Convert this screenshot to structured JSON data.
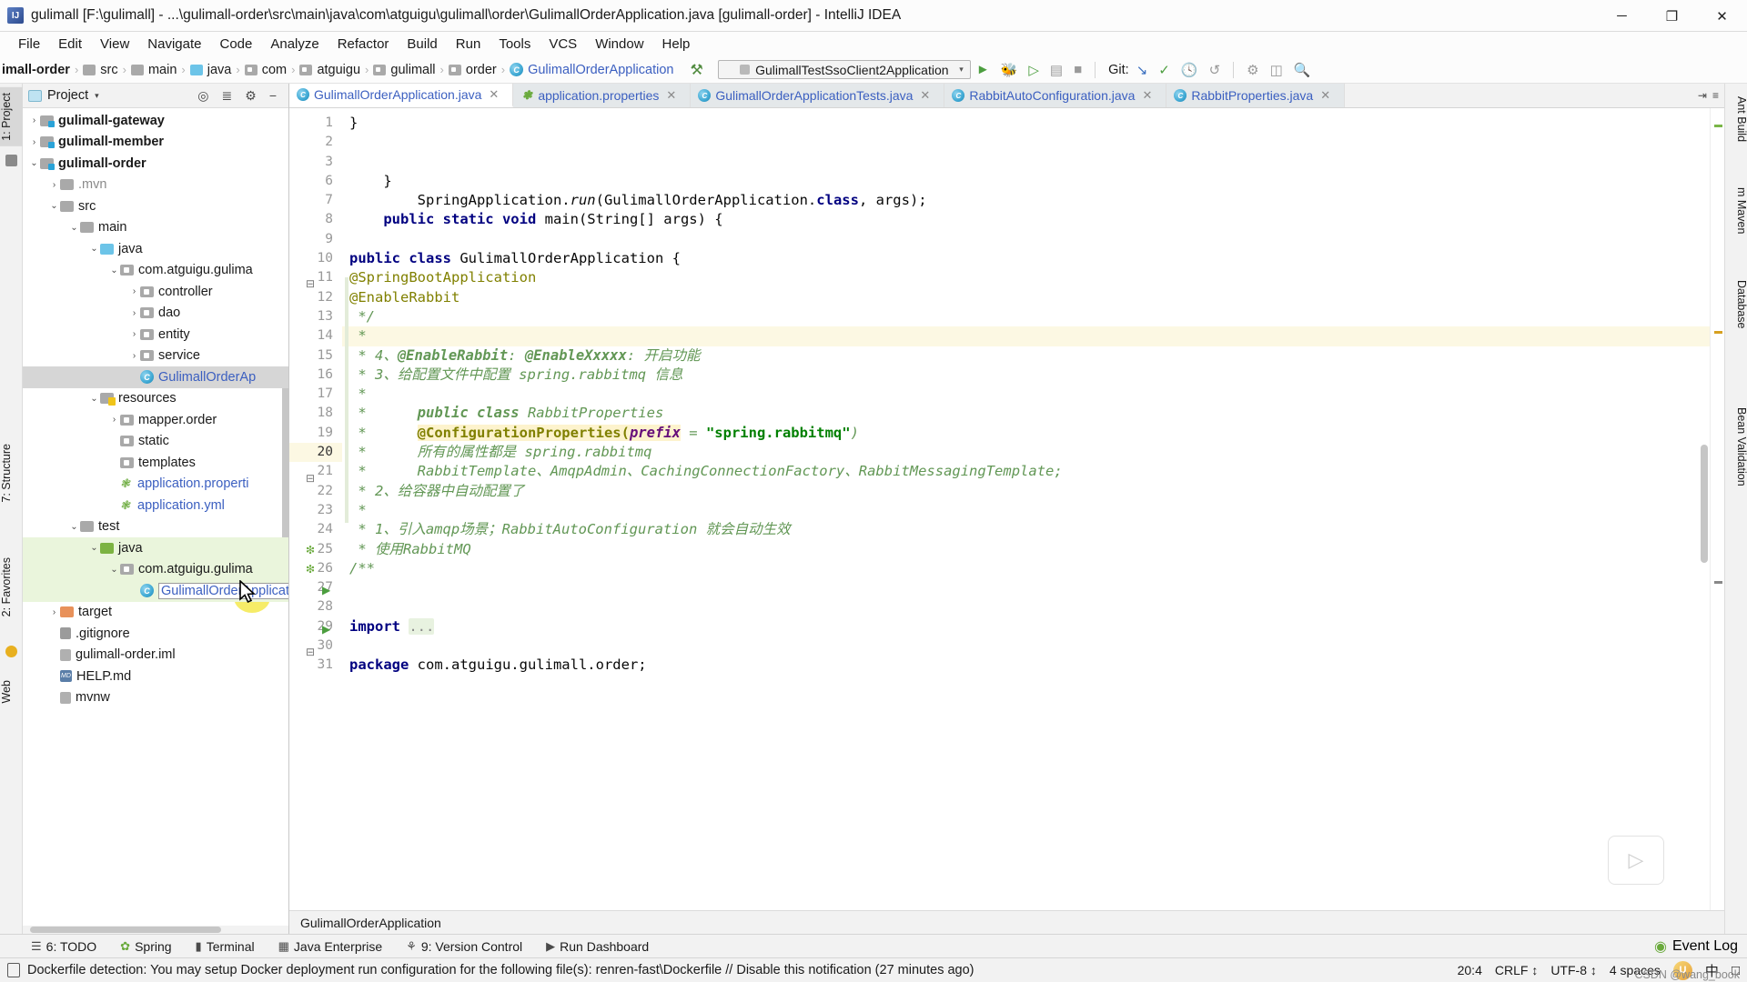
{
  "window": {
    "title": "gulimall [F:\\gulimall] - ...\\gulimall-order\\src\\main\\java\\com\\atguigu\\gulimall\\order\\GulimallOrderApplication.java [gulimall-order] - IntelliJ IDEA",
    "app_icon": "intellij-idea-icon",
    "minimize": "─",
    "maximize": "❐",
    "close": "✕"
  },
  "menubar": {
    "items": [
      {
        "label": "File"
      },
      {
        "label": "Edit"
      },
      {
        "label": "View"
      },
      {
        "label": "Navigate"
      },
      {
        "label": "Code"
      },
      {
        "label": "Analyze"
      },
      {
        "label": "Refactor"
      },
      {
        "label": "Build"
      },
      {
        "label": "Run"
      },
      {
        "label": "Tools"
      },
      {
        "label": "VCS"
      },
      {
        "label": "Window"
      },
      {
        "label": "Help"
      }
    ]
  },
  "breadcrumb": {
    "items": [
      {
        "label": "imall-order",
        "icon": "module-icon"
      },
      {
        "label": "src",
        "icon": "folder-icon"
      },
      {
        "label": "main",
        "icon": "folder-icon"
      },
      {
        "label": "java",
        "icon": "source-folder-icon"
      },
      {
        "label": "com",
        "icon": "package-icon"
      },
      {
        "label": "atguigu",
        "icon": "package-icon"
      },
      {
        "label": "gulimall",
        "icon": "package-icon"
      },
      {
        "label": "order",
        "icon": "package-icon"
      },
      {
        "label": "GulimallOrderApplication",
        "icon": "java-class-icon"
      }
    ],
    "separator": "›"
  },
  "toolbar": {
    "build_icon": "hammer-icon",
    "run_config": "GulimallTestSsoClient2Application",
    "run_config_caret": "▾",
    "run_button": "run-icon",
    "debug_button": "debug-icon",
    "run_coverage_button": "run-with-coverage-icon",
    "profiler_button": "profiler-icon",
    "stop_button": "stop-icon",
    "git_label": "Git:",
    "git_update": "update-project-icon",
    "git_commit": "commit-icon",
    "git_history": "history-icon",
    "git_rollback": "rollback-icon",
    "settings_icon": "settings-icon",
    "layout_icon": "layout-icon",
    "search_icon": "search-icon"
  },
  "left_strips": [
    {
      "label": "1: Project",
      "selected": true
    },
    {
      "label": "7: Structure",
      "selected": false
    },
    {
      "label": "2: Favorites",
      "selected": false
    },
    {
      "label": "Web",
      "selected": false
    }
  ],
  "right_strips": [
    {
      "label": "Ant Build"
    },
    {
      "label": "m Maven"
    },
    {
      "label": "Database"
    },
    {
      "label": "Bean Validation"
    }
  ],
  "project_panel": {
    "title": "Project",
    "title_caret": "▾",
    "panel_icon": "project-view-icon",
    "locate_icon": "locate-icon",
    "collapse_icon": "collapse-all-icon",
    "settings_icon": "gear-icon",
    "hide_icon": "hide-icon",
    "tree": [
      {
        "label": "gulimall-gateway",
        "indent": 1,
        "arrow": "›",
        "icon": "module-icon",
        "style": "bold"
      },
      {
        "label": "gulimall-member",
        "indent": 1,
        "arrow": "›",
        "icon": "module-icon",
        "style": "bold"
      },
      {
        "label": "gulimall-order",
        "indent": 1,
        "arrow": "⌄",
        "icon": "module-icon",
        "style": "bold"
      },
      {
        "label": ".mvn",
        "indent": 2,
        "arrow": "›",
        "icon": "folder-icon",
        "style": "grey"
      },
      {
        "label": "src",
        "indent": 2,
        "arrow": "⌄",
        "icon": "folder-icon",
        "style": "normal"
      },
      {
        "label": "main",
        "indent": 3,
        "arrow": "⌄",
        "icon": "folder-icon",
        "style": "normal"
      },
      {
        "label": "java",
        "indent": 4,
        "arrow": "⌄",
        "icon": "source-folder-icon",
        "style": "normal"
      },
      {
        "label": "com.atguigu.gulima",
        "indent": 5,
        "arrow": "⌄",
        "icon": "package-icon",
        "style": "normal"
      },
      {
        "label": "controller",
        "indent": 6,
        "arrow": "›",
        "icon": "package-icon",
        "style": "normal"
      },
      {
        "label": "dao",
        "indent": 6,
        "arrow": "›",
        "icon": "package-icon",
        "style": "normal"
      },
      {
        "label": "entity",
        "indent": 6,
        "arrow": "›",
        "icon": "package-icon",
        "style": "normal"
      },
      {
        "label": "service",
        "indent": 6,
        "arrow": "›",
        "icon": "package-icon",
        "style": "normal"
      },
      {
        "label": "GulimallOrderAp",
        "indent": 6,
        "arrow": "",
        "icon": "java-class-icon",
        "style": "blue",
        "selected": true
      },
      {
        "label": "resources",
        "indent": 4,
        "arrow": "⌄",
        "icon": "resources-folder-icon",
        "style": "normal"
      },
      {
        "label": "mapper.order",
        "indent": 5,
        "arrow": "›",
        "icon": "package-icon",
        "style": "normal"
      },
      {
        "label": "static",
        "indent": 5,
        "arrow": "",
        "icon": "package-icon",
        "style": "normal"
      },
      {
        "label": "templates",
        "indent": 5,
        "arrow": "",
        "icon": "package-icon",
        "style": "normal"
      },
      {
        "label": "application.properti",
        "indent": 5,
        "arrow": "",
        "icon": "spring-properties-icon",
        "style": "blue"
      },
      {
        "label": "application.yml",
        "indent": 5,
        "arrow": "",
        "icon": "spring-properties-icon",
        "style": "blue"
      },
      {
        "label": "test",
        "indent": 3,
        "arrow": "⌄",
        "icon": "folder-icon",
        "style": "normal"
      },
      {
        "label": "java",
        "indent": 4,
        "arrow": "⌄",
        "icon": "test-source-folder-icon",
        "style": "normal",
        "green": true
      },
      {
        "label": "com.atguigu.gulima",
        "indent": 5,
        "arrow": "⌄",
        "icon": "package-icon",
        "style": "normal",
        "green": true
      },
      {
        "label": "GulimallOrderApplicationTests",
        "indent": 6,
        "arrow": "",
        "icon": "java-class-icon",
        "style": "blue",
        "green": true,
        "boxed": true
      },
      {
        "label": "target",
        "indent": 2,
        "arrow": "›",
        "icon": "target-folder-icon",
        "style": "normal"
      },
      {
        "label": ".gitignore",
        "indent": 2,
        "arrow": "",
        "icon": "gitignore-icon",
        "style": "normal"
      },
      {
        "label": "gulimall-order.iml",
        "indent": 2,
        "arrow": "",
        "icon": "iml-icon",
        "style": "normal"
      },
      {
        "label": "HELP.md",
        "indent": 2,
        "arrow": "",
        "icon": "markdown-icon",
        "style": "normal"
      },
      {
        "label": "mvnw",
        "indent": 2,
        "arrow": "",
        "icon": "file-icon",
        "style": "normal"
      }
    ]
  },
  "editor": {
    "tabs": [
      {
        "label": "GulimallOrderApplication.java",
        "icon": "java-class-icon",
        "active": true,
        "close": "✕"
      },
      {
        "label": "application.properties",
        "icon": "spring-properties-icon",
        "active": false,
        "close": "✕"
      },
      {
        "label": "GulimallOrderApplicationTests.java",
        "icon": "java-class-icon",
        "active": false,
        "close": "✕"
      },
      {
        "label": "RabbitAutoConfiguration.java",
        "icon": "java-class-icon",
        "active": false,
        "close": "✕"
      },
      {
        "label": "RabbitProperties.java",
        "icon": "java-class-icon",
        "active": false,
        "close": "✕"
      }
    ],
    "tab_overflow": "⇥",
    "tab_menu": "≡",
    "line_numbers": [
      1,
      2,
      3,
      6,
      7,
      8,
      9,
      10,
      11,
      12,
      13,
      14,
      15,
      16,
      17,
      18,
      19,
      20,
      21,
      22,
      23,
      24,
      25,
      26,
      27,
      28,
      29,
      30,
      31
    ],
    "current_line": 20,
    "status_breadcrumb": "GulimallOrderApplication",
    "code_lines": [
      {
        "n": 1,
        "text": "package com.atguigu.gulimall.order;"
      },
      {
        "n": 2,
        "text": ""
      },
      {
        "n": 3,
        "text": "import ..."
      },
      {
        "n": 6,
        "text": ""
      },
      {
        "n": 7,
        "text": ""
      },
      {
        "n": 8,
        "text": "/**"
      },
      {
        "n": 9,
        "text": " * 使用RabbitMQ"
      },
      {
        "n": 10,
        "text": " * 1、引入amqp场景；RabbitAutoConfiguration 就会自动生效"
      },
      {
        "n": 11,
        "text": " *"
      },
      {
        "n": 12,
        "text": " * 2、给容器中自动配置了"
      },
      {
        "n": 13,
        "text": " *      RabbitTemplate、AmqpAdmin、CachingConnectionFactory、RabbitMessagingTemplate;"
      },
      {
        "n": 14,
        "text": " *      所有的属性都是 spring.rabbitmq"
      },
      {
        "n": 15,
        "text": " *      @ConfigurationProperties(prefix = \"spring.rabbitmq\")"
      },
      {
        "n": 16,
        "text": " *      public class RabbitProperties"
      },
      {
        "n": 17,
        "text": " *"
      },
      {
        "n": 18,
        "text": " * 3、给配置文件中配置 spring.rabbitmq 信息"
      },
      {
        "n": 19,
        "text": " * 4、@EnableRabbit: @EnableXxxxx: 开启功能"
      },
      {
        "n": 20,
        "text": " *"
      },
      {
        "n": 21,
        "text": " */"
      },
      {
        "n": 22,
        "text": "@EnableRabbit"
      },
      {
        "n": 23,
        "text": "@SpringBootApplication"
      },
      {
        "n": 24,
        "text": "public class GulimallOrderApplication {"
      },
      {
        "n": 25,
        "text": ""
      },
      {
        "n": 26,
        "text": "    public static void main(String[] args) {"
      },
      {
        "n": 27,
        "text": "        SpringApplication.run(GulimallOrderApplication.class, args);"
      },
      {
        "n": 28,
        "text": "    }"
      },
      {
        "n": 29,
        "text": ""
      },
      {
        "n": 30,
        "text": ""
      },
      {
        "n": 31,
        "text": "}"
      }
    ]
  },
  "toolwindow_bar": {
    "items": [
      {
        "label": "6: TODO",
        "icon": "todo-icon",
        "mnemonic": "6"
      },
      {
        "label": "Spring",
        "icon": "spring-leaf-icon"
      },
      {
        "label": "Terminal",
        "icon": "terminal-icon"
      },
      {
        "label": "Java Enterprise",
        "icon": "java-enterprise-icon"
      },
      {
        "label": "9: Version Control",
        "icon": "version-control-icon",
        "mnemonic": "9"
      },
      {
        "label": "Run Dashboard",
        "icon": "run-dashboard-icon"
      }
    ],
    "event_log": "Event Log",
    "event_log_icon": "event-log-icon"
  },
  "notification": {
    "icon": "docker-file-icon",
    "text": "Dockerfile detection: You may setup Docker deployment run configuration for the following file(s): renren-fast\\Dockerfile // Disable this notification (27 minutes ago)",
    "caret_position": "20:4",
    "line_separator": "CRLF",
    "line_separator_caret": "↕",
    "encoding": "UTF-8",
    "encoding_caret": "↕",
    "indent": "4 spaces",
    "ime_badge": "U",
    "ime_lang": "中",
    "ime_mode": "□"
  },
  "watermark": "CSDN @wang_book",
  "colors": {
    "accent_blue": "#3b5fc0",
    "comment_green": "#629755",
    "keyword_navy": "#000080",
    "string_green": "#008000",
    "annotation_olive": "#808000",
    "highlight_yellow": "#fcf8e3",
    "selection_grey": "#d6d6d6",
    "test_green_bg": "#eaf5dc"
  }
}
